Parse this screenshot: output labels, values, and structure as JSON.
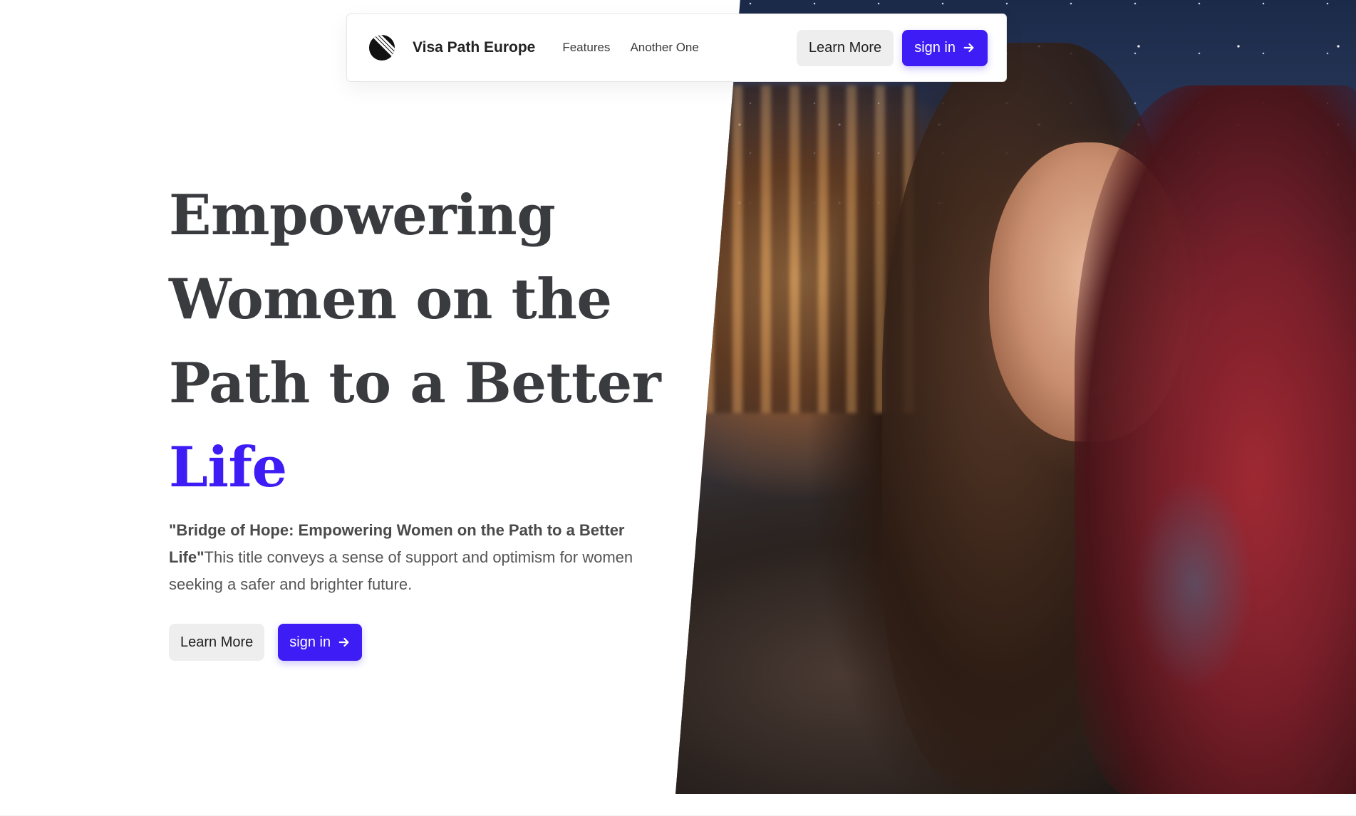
{
  "nav": {
    "brand": "Visa Path Europe",
    "links": [
      "Features",
      "Another One"
    ],
    "learn_more": "Learn More",
    "sign_in": "sign in"
  },
  "hero": {
    "title_lines": [
      "Empowering",
      "Women on the",
      "Path to a Better"
    ],
    "title_accent": "Life",
    "desc_bold": "\"Bridge of Hope: Empowering Women on the Path to a Better Life\"",
    "desc_rest": "This title conveys a sense of support and optimism for women seeking a safer and brighter future.",
    "learn_more": "Learn More",
    "sign_in": "sign in"
  },
  "colors": {
    "accent": "#3d1cf5",
    "heading": "#3a3b3f",
    "button_light": "#eeeeee"
  },
  "icons": {
    "logo": "striped-circle-logo-icon",
    "arrow": "arrow-right-icon"
  }
}
